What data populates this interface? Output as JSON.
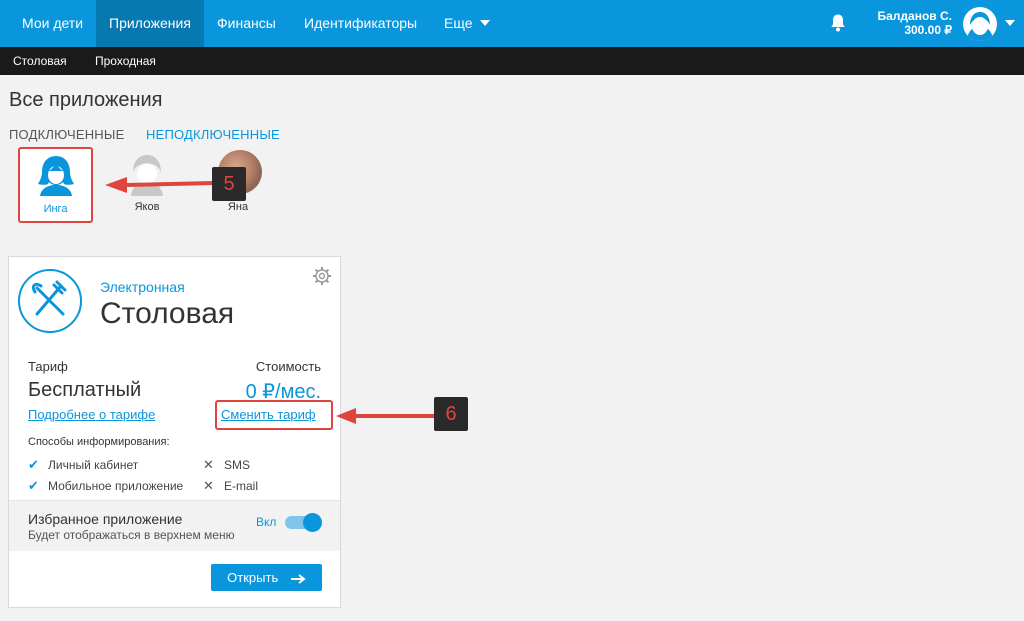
{
  "topnav": {
    "items": [
      "Мои дети",
      "Приложения",
      "Финансы",
      "Идентификаторы",
      "Еще"
    ],
    "user_name": "Балданов С.",
    "balance": "300.00 ₽"
  },
  "subnav": {
    "items": [
      "Столовая",
      "Проходная"
    ]
  },
  "page": {
    "title": "Все приложения",
    "tab_connected": "ПОДКЛЮЧЕННЫЕ",
    "tab_disconnected": "НЕПОДКЛЮЧЕННЫЕ"
  },
  "children": [
    "Инга",
    "Яков",
    "Яна"
  ],
  "callouts": {
    "first": "5",
    "second": "6"
  },
  "card": {
    "subtitle": "Электронная",
    "title": "Столовая",
    "tariff_label": "Тариф",
    "cost_label": "Стоимость",
    "tariff_value": "Бесплатный",
    "price": "0 ₽/мес.",
    "details_link": "Подробнее о тарифе",
    "change_link": "Сменить тариф",
    "notify_label": "Способы информирования:",
    "notify_enabled": [
      "Личный кабинет",
      "Мобильное приложение"
    ],
    "notify_disabled": [
      "SMS",
      "E-mail"
    ],
    "fav_title": "Избранное приложение",
    "fav_sub": "Будет отображаться в верхнем меню",
    "fav_state": "Вкл",
    "open_button": "Открыть"
  },
  "colors": {
    "accent": "#0a96dc",
    "annotation": "#e0443e"
  }
}
